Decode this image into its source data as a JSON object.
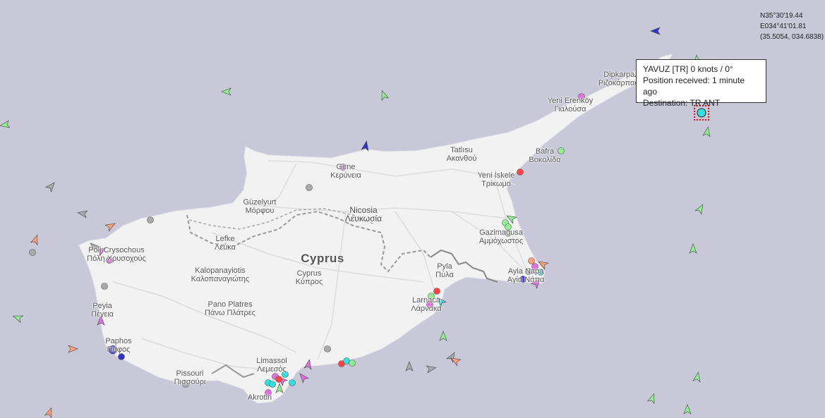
{
  "map": {
    "country_label": "Cyprus",
    "capital": {
      "name": "Nicosia",
      "alt": "Λευκωσία"
    },
    "places": [
      {
        "key": "dipkarpaz",
        "name": "Dipkarpaz",
        "alt": "Ριζοκάρπασο"
      },
      {
        "key": "yenierenkoy",
        "name": "Yeni Erenköy",
        "alt": "Γιαλούσα"
      },
      {
        "key": "tatlisu",
        "name": "Tatlısu",
        "alt": "Ακανθού"
      },
      {
        "key": "bafra",
        "name": "Bafra",
        "alt": "Βοκολίδα"
      },
      {
        "key": "girne",
        "name": "Girne",
        "alt": "Κερύνεια"
      },
      {
        "key": "yeniiskele",
        "name": "Yeni İskele",
        "alt": "Τρίκωμο"
      },
      {
        "key": "guzelyurt",
        "name": "Güzelyurt",
        "alt": "Μόρφου"
      },
      {
        "key": "gazimagusa",
        "name": "Gazimağusa",
        "alt": "Αμμόχωστος"
      },
      {
        "key": "lefke",
        "name": "Lefke",
        "alt": "Λεύκα"
      },
      {
        "key": "poli",
        "name": "Poli Crysochous",
        "alt": "Πόλη Χρυσοχούς"
      },
      {
        "key": "pyla",
        "name": "Pyla",
        "alt": "Πύλα"
      },
      {
        "key": "ayianapa",
        "name": "Ayia Napa",
        "alt": "Αγία Νάπα"
      },
      {
        "key": "kalopanayiotis",
        "name": "Kalopanayiotis",
        "alt": "Καλοπαναγιώτης"
      },
      {
        "key": "cyprus_town",
        "name": "Cyprus",
        "alt": "Κύπρος"
      },
      {
        "key": "peyia",
        "name": "Peyia",
        "alt": "Πέγεια"
      },
      {
        "key": "larnaca",
        "name": "Larnaca",
        "alt": "Λάρνακα"
      },
      {
        "key": "panoplatres",
        "name": "Pano Platres",
        "alt": "Πάνω Πλάτρες"
      },
      {
        "key": "paphos",
        "name": "Paphos",
        "alt": "Πάφος"
      },
      {
        "key": "limassol",
        "name": "Limassol",
        "alt": "Λεμεσός"
      },
      {
        "key": "pissouri",
        "name": "Pissouri",
        "alt": "Πισσούρι"
      },
      {
        "key": "akrotiri",
        "name": "Akrotiri",
        "alt": ""
      }
    ]
  },
  "cursor_coords": {
    "lat": "N35°30'19.44",
    "lon": "E034°41'01.81",
    "decimal": "(35.5054, 034.6838)"
  },
  "tooltip": {
    "title": "YAVUZ [TR] 0 knots / 0°",
    "position": "Position received: 1 minute ago",
    "destination": "Destination: TR ANT"
  },
  "colors": {
    "sea": "#c8c8d8",
    "land": "#f2f2f2",
    "cargo": "#8ef08e",
    "tanker": "#ff4444",
    "passenger": "#3333cc",
    "tug": "#33e0e0",
    "pleasure": "#e070e0",
    "unknown": "#aaaaaa",
    "fishing": "#ffa07a"
  }
}
